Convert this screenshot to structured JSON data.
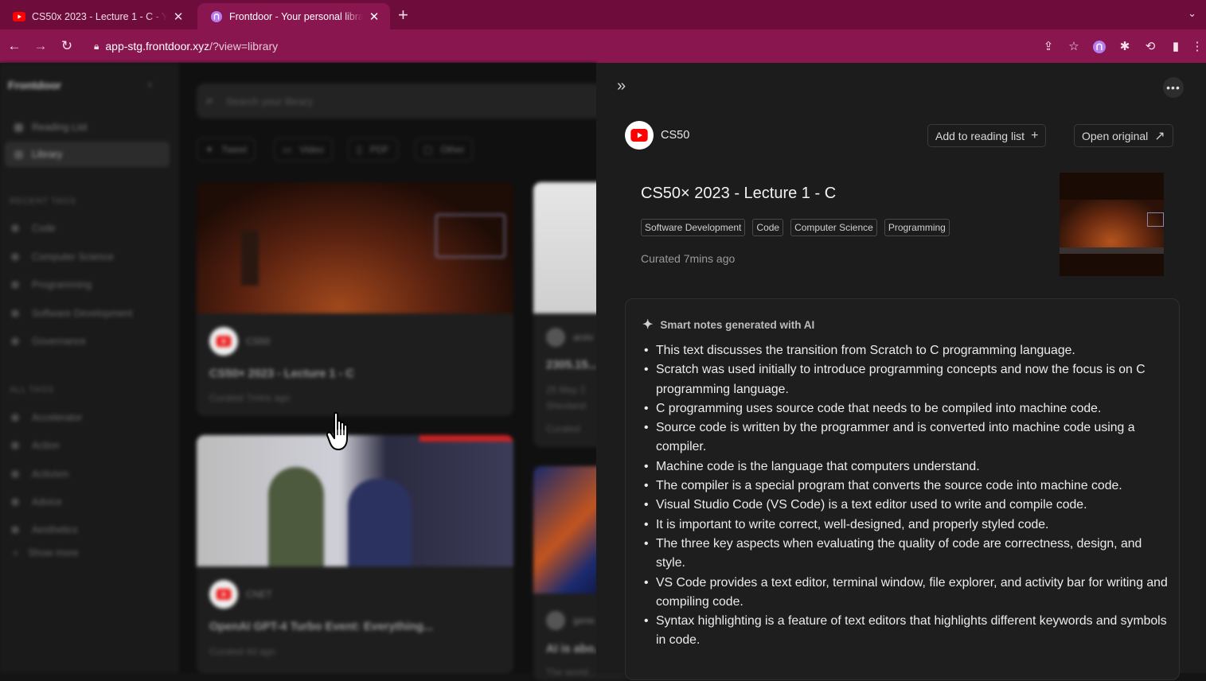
{
  "browser": {
    "tabs": [
      {
        "title": "CS50x 2023 - Lecture 1 - C - YouTube",
        "active": false
      },
      {
        "title": "Frontdoor - Your personal library",
        "active": true
      }
    ],
    "url_host": "app-stg.frontdoor.xyz",
    "url_path": "/?view=library",
    "accent": "#8a1650"
  },
  "sidebar": {
    "logo": "Frontdoor",
    "nav": [
      {
        "label": "Reading List"
      },
      {
        "label": "Library",
        "active": true
      }
    ],
    "recent_tags_heading": "RECENT TAGS",
    "recent_tags": [
      "Code",
      "Computer Science",
      "Programming",
      "Software Development",
      "Governance"
    ],
    "all_tags_heading": "ALL TAGS",
    "all_tags": [
      "Accelerator",
      "Action",
      "Activism",
      "Advice",
      "Aesthetics"
    ],
    "show_more": "Show more"
  },
  "library": {
    "search_placeholder": "Search your library",
    "filters": [
      "Tweet",
      "Video",
      "PDF",
      "Other"
    ],
    "cards": [
      {
        "channel": "CS50",
        "title": "CS50× 2023 - Lecture 1 - C",
        "date": "Curated 7mins ago"
      },
      {
        "channel": "arxiv",
        "title": "2305.15...",
        "date": "25 May 2",
        "extra": "Shevland",
        "date2": "Curated"
      },
      {
        "channel": "CNET",
        "title": "OpenAI GPT-4 Turbo Event: Everything...",
        "date": "Curated 4d ago"
      },
      {
        "channel": "gene...",
        "title": "AI is abo...",
        "date": "The world..."
      }
    ]
  },
  "panel": {
    "source": "CS50",
    "add_label": "Add to reading list",
    "open_label": "Open original",
    "title": "CS50× 2023 - Lecture 1 - C",
    "tags": [
      "Software Development",
      "Code",
      "Computer Science",
      "Programming"
    ],
    "curated": "Curated 7mins ago",
    "notes_heading": "Smart notes generated with AI",
    "notes": [
      "This text discusses the transition from Scratch to C programming language.",
      "Scratch was used initially to introduce programming concepts and now the focus is on C programming language.",
      "C programming uses source code that needs to be compiled into machine code.",
      "Source code is written by the programmer and is converted into machine code using a compiler.",
      "Machine code is the language that computers understand.",
      "The compiler is a special program that converts the source code into machine code.",
      "Visual Studio Code (VS Code) is a text editor used to write and compile code.",
      "It is important to write correct, well-designed, and properly styled code.",
      "The three key aspects when evaluating the quality of code are correctness, design, and style.",
      "VS Code provides a text editor, terminal window, file explorer, and activity bar for writing and compiling code.",
      "Syntax highlighting is a feature of text editors that highlights different keywords and symbols in code."
    ]
  }
}
